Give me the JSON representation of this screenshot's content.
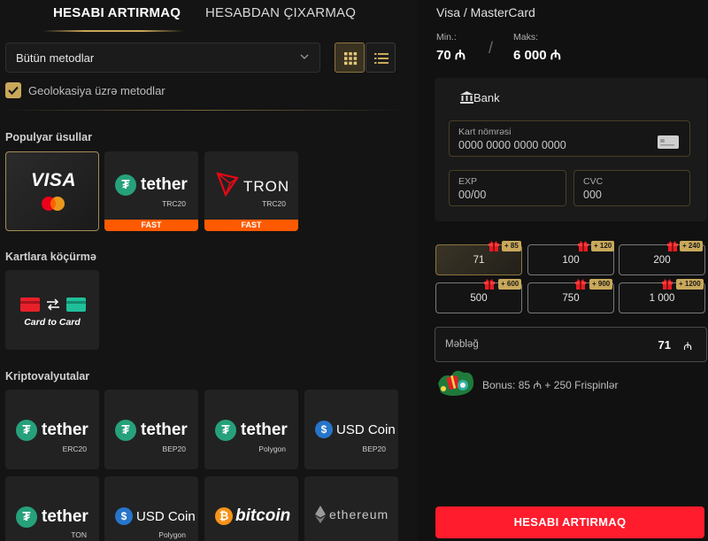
{
  "tabs": {
    "deposit": "HESABI ARTIRMAQ",
    "withdraw": "HESABDAN ÇIXARMAQ"
  },
  "filter": {
    "method_select": "Bütün metodlar",
    "geo_checkbox": "Geolokasiya üzrə metodlar"
  },
  "sections": {
    "popular": "Populyar üsullar",
    "card_transfer": "Kartlara köçürmə",
    "crypto": "Kriptovalyutalar"
  },
  "popular_methods": [
    {
      "name": "VISA",
      "sub": ""
    },
    {
      "name": "tether",
      "sub": "TRC20",
      "badge": "FAST"
    },
    {
      "name": "TRON",
      "sub": "TRC20",
      "badge": "FAST"
    }
  ],
  "card_methods": [
    {
      "name": "Card to Card"
    }
  ],
  "crypto_methods": [
    {
      "name": "tether",
      "sub": "ERC20"
    },
    {
      "name": "tether",
      "sub": "BEP20"
    },
    {
      "name": "tether",
      "sub": "Polygon"
    },
    {
      "name": "USD Coin",
      "sub": "BEP20"
    },
    {
      "name": "tether",
      "sub": "TON"
    },
    {
      "name": "USD Coin",
      "sub": "Polygon"
    },
    {
      "name": "bitcoin",
      "sub": ""
    },
    {
      "name": "ethereum",
      "sub": ""
    }
  ],
  "payment": {
    "title": "Visa / MasterCard",
    "min_label": "Min.:",
    "min_value": "70",
    "max_label": "Maks:",
    "max_value": "6 000",
    "currency": "₼",
    "bank_label": "Bank",
    "card_number_label": "Kart nömrəsi",
    "card_number_placeholder": "0000 0000 0000 0000",
    "exp_label": "EXP",
    "exp_placeholder": "00/00",
    "cvc_label": "CVC",
    "cvc_placeholder": "000"
  },
  "amount_options": [
    {
      "value": "71",
      "bonus": "+ 85"
    },
    {
      "value": "100",
      "bonus": "+ 120"
    },
    {
      "value": "200",
      "bonus": "+ 240"
    },
    {
      "value": "500",
      "bonus": "+ 600"
    },
    {
      "value": "750",
      "bonus": "+ 900"
    },
    {
      "value": "1 000",
      "bonus": "+ 1200"
    }
  ],
  "amount_field": {
    "label": "Məbləğ",
    "value": "71"
  },
  "bonus_info": "Bonus: 85 ₼ + 250 Frispinlər",
  "submit_label": "HESABI ARTIRMAQ",
  "colors": {
    "accent_gold": "#c9a85a",
    "submit_red": "#ff1c2c",
    "fast_orange": "#ff5a00",
    "tether_green": "#26a17b",
    "usdc_blue": "#2775ca",
    "tron_red": "#e50915",
    "bitcoin_orange": "#f7931a"
  }
}
